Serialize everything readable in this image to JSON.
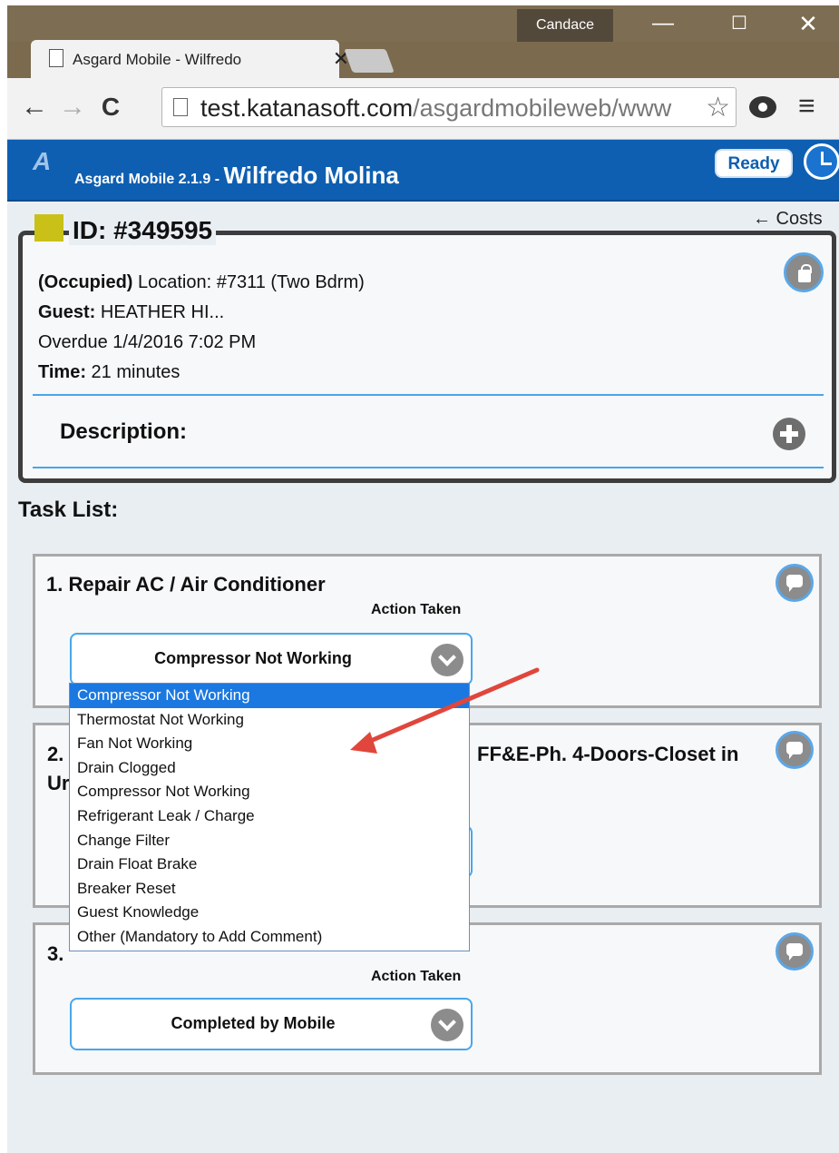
{
  "browser": {
    "profile_name": "Candace",
    "window_controls": {
      "minimize": "—",
      "maximize": "☐",
      "close": "✕"
    },
    "tab": {
      "title": "Asgard Mobile - Wilfredo",
      "close": "✕"
    },
    "nav": {
      "back": "←",
      "forward": "→",
      "reload": "C"
    },
    "url_host": "test.katanasoft.com",
    "url_path": "/asgardmobileweb/www",
    "bookmark_star": "☆",
    "menu": "≡"
  },
  "app": {
    "logo": "A",
    "version": "Asgard Mobile 2.1.9 - ",
    "user_name": "Wilfredo Molina",
    "status": "Ready",
    "accent_color": "#0e5fb1"
  },
  "job": {
    "costs_link": "← Costs",
    "id": "ID: #349595",
    "status_prefix": "(Occupied)",
    "location": " Location: #7311 (Two Bdrm)",
    "guest_label": "Guest:",
    "guest_value": " HEATHER HI...",
    "overdue": "Overdue 1/4/2016 7:02 PM",
    "time_label": "Time:",
    "time_value": " 21 minutes",
    "description_label": "Description:"
  },
  "tasks": {
    "heading": "Task List:",
    "items": [
      {
        "title": "1. Repair AC / Air Conditioner",
        "action_label": "Action Taken",
        "selected": "Compressor Not Working"
      },
      {
        "title_start": "2.",
        "title_end": "FF&E-Ph. 4-Doors-Closet in",
        "title_wrap": "Ur"
      },
      {
        "title_start": "3.",
        "action_label": "Action Taken",
        "selected": "Completed by Mobile"
      }
    ]
  },
  "dropdown": {
    "options": [
      "Compressor Not Working",
      "Thermostat Not Working",
      "Fan Not Working",
      "Drain Clogged",
      "Compressor Not Working",
      "Refrigerant Leak / Charge",
      "Change Filter",
      "Drain Float Brake",
      "Breaker Reset",
      "Guest Knowledge",
      "Other (Mandatory to Add Comment)"
    ],
    "highlighted_index": 0
  }
}
